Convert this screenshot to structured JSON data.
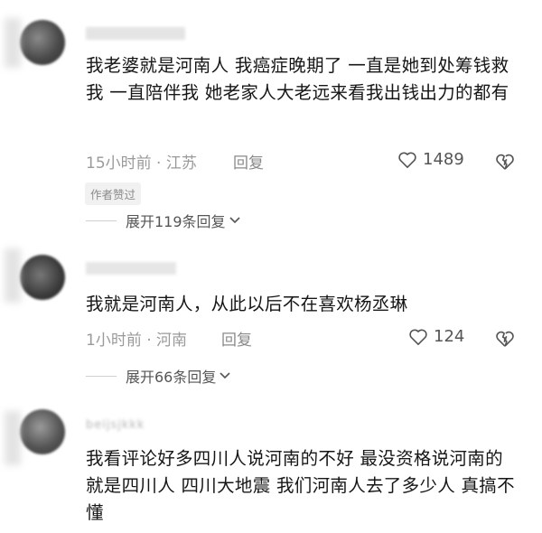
{
  "comments": [
    {
      "text": "我老婆就是河南人 我癌症晚期了 一直是她到处筹钱救我 一直陪伴我 她老家人大老远来看我出钱出力的都有",
      "time_location": "15小时前 · 江苏",
      "reply_label": "回复",
      "likes": "1489",
      "author_badge": "作者赞过",
      "expand_label": "展开119条回复"
    },
    {
      "text": "我就是河南人，从此以后不在喜欢杨丞琳",
      "time_location": "1小时前 · 河南",
      "reply_label": "回复",
      "likes": "124",
      "expand_label": "展开66条回复"
    },
    {
      "username": "beijsjkkk",
      "text": "我看评论好多四川人说河南的不好 最没资格说河南的就是四川人 四川大地震 我们河南人去了多少人 真搞不懂"
    }
  ],
  "icons": {
    "like": "heart-outline-icon",
    "dislike": "broken-heart-icon",
    "expand": "chevron-down-icon"
  }
}
